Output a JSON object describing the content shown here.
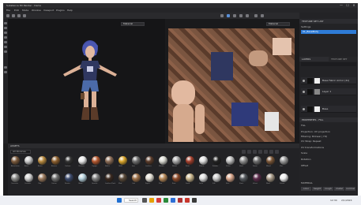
{
  "window": {
    "title": "Substance 3D Painter - Demo",
    "controls": [
      "—",
      "☐",
      "✕"
    ]
  },
  "menu": [
    "File",
    "Edit",
    "Mode",
    "Window",
    "Viewport",
    "Plugins",
    "Help"
  ],
  "viewport3d": {
    "dropdown": "Material"
  },
  "viewport2d": {
    "dropdown": "Material"
  },
  "right_panel": {
    "texture_set_header": "TEXTURE SET LIST",
    "texture_set_label": "Settings",
    "texture_set_item": "01_BaseBody",
    "layers_tab": "LAYERS",
    "tex_settings_tab": "TEXTURE SET SETTINGS",
    "layers": [
      {
        "name": "Base Fabric Armor (2x)"
      },
      {
        "name": "Layer 1"
      },
      {
        "name": "Base"
      }
    ],
    "properties_header": "PROPERTIES - FILL",
    "props": [
      "FILL",
      "Projection: UV projection",
      "Filtering: Bilinear | HQ",
      "UV Wrap: Repeat",
      "UV transformations",
      "Scale",
      "Rotation",
      "Offset"
    ],
    "material_label": "MATERIAL",
    "material_buttons": [
      "color",
      "height",
      "rough",
      "metal",
      "normal"
    ]
  },
  "shelf": {
    "header": "ASSETS",
    "search_placeholder": "All libraries",
    "row1": [
      "Aluminium",
      "Bone",
      "Brass",
      "Bronze",
      "Carbon",
      "Chrome",
      "Copper",
      "Fabric",
      "Gold",
      "Iron",
      "Leather",
      "Marble",
      "Nickel",
      "Paint",
      "Plastic",
      "Rubber",
      "Silver",
      "Steel",
      "Stone",
      "Wood",
      "Zinc"
    ],
    "row2": [
      "Concrete",
      "Ceramic",
      "Clay",
      "Cotton",
      "Denim",
      "Glass",
      "Granite",
      "Leather Dark",
      "Mud",
      "Oak",
      "Paper",
      "Pine",
      "Rust",
      "Sand",
      "Satin",
      "Silk",
      "Skin",
      "Slate",
      "Velvet",
      "Wool",
      "Zebra"
    ]
  },
  "taskbar": {
    "search": "Search",
    "time": "12:34",
    "date": "2/1/2024",
    "lang": "ENG"
  },
  "colors": {
    "accent": "#2e7bd6",
    "panel": "#232326",
    "viewport": "#151517"
  }
}
